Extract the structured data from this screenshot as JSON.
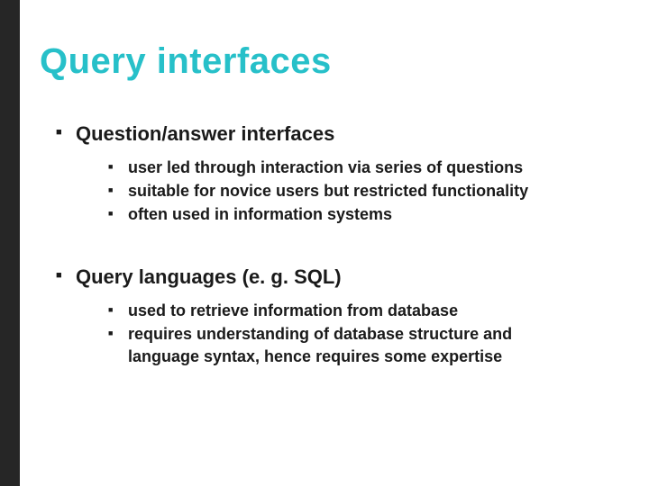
{
  "slide": {
    "title": "Query interfaces",
    "sections": [
      {
        "heading": "Question/answer interfaces",
        "items": [
          "user led through interaction via series of questions",
          "suitable for novice users but restricted functionality",
          "often used in information systems"
        ]
      },
      {
        "heading": "Query languages (e. g. SQL)",
        "items": [
          "used to retrieve information from database",
          "requires understanding of database structure and language syntax, hence requires some expertise"
        ]
      }
    ]
  }
}
